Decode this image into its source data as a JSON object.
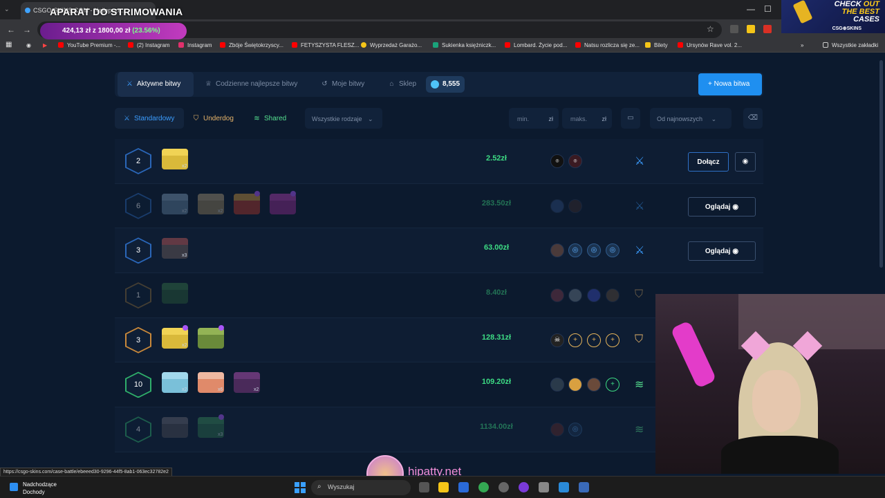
{
  "browser": {
    "tab_title": "CSGO-SKINS.COM - Najlepsze...",
    "overlay_title": "APARAT DO STRIMOWANIA",
    "money_overlay": {
      "text": "424,13 zł z 1800,00 zł",
      "percent": "(23.56%)"
    },
    "bookmarks": [
      {
        "label": "YouTube Premium -...",
        "color": "#ff0000"
      },
      {
        "label": "(2) Instagram",
        "color": "#ff0000"
      },
      {
        "label": "Instagram",
        "color": "#e1306c"
      },
      {
        "label": "Zbóje Świętokrzyscy...",
        "color": "#ff0000"
      },
      {
        "label": "FETYSZYSTA FLESZ...",
        "color": "#ff0000"
      },
      {
        "label": "Wyprzedaż Garażo...",
        "color": "#f5c518"
      },
      {
        "label": "Sukienka księżniczk...",
        "color": "#1aa37a"
      },
      {
        "label": "Lombard. Życie pod...",
        "color": "#ff0000"
      },
      {
        "label": "Natsu rozlicza się ze...",
        "color": "#ff0000"
      },
      {
        "label": "Bilety",
        "color": "#f5c518"
      },
      {
        "label": "Ursynów Rave vol. 2...",
        "color": "#ff0000"
      }
    ],
    "all_bookmarks": "Wszystkie zakładki",
    "status_url": "https://csgo-skins.com/case-battle/ebeeed30-9296-44f5-8ab1-063ec32782e2"
  },
  "promo": {
    "line1": "CHECK",
    "line1b": "OUT",
    "line2": "THE BEST",
    "line3": "CASES",
    "logo": "CSG⊕SKINS"
  },
  "nav": {
    "active": "Aktywne bitwy",
    "daily": "Codzienne najlepsze bitwy",
    "mine": "Moje bitwy",
    "shop": "Sklep",
    "coins": "8,555",
    "new_battle": "+ Nowa bitwa"
  },
  "filters": {
    "standard": "Standardowy",
    "underdog": "Underdog",
    "shared": "Shared",
    "all_types": "Wszystkie rodzaje",
    "min_placeholder": "min.",
    "max_placeholder": "maks.",
    "currency": "zł",
    "sort": "Od najnowszych"
  },
  "battles": [
    {
      "rounds": "2",
      "price": "2.52zł",
      "mode": "standard",
      "action": "Dołącz",
      "hex": "#2a66b8",
      "dim": false
    },
    {
      "rounds": "6",
      "price": "283.50zł",
      "mode": "standard",
      "action": "Oglądaj",
      "hex": "#2a66b8",
      "dim": true
    },
    {
      "rounds": "3",
      "price": "63.00zł",
      "mode": "standard",
      "action": "Oglądaj",
      "hex": "#2a66b8",
      "dim": false
    },
    {
      "rounds": "1",
      "price": "8.40zł",
      "mode": "underdog",
      "action": "",
      "hex": "#8a6a3a",
      "dim": true
    },
    {
      "rounds": "3",
      "price": "128.31zł",
      "mode": "underdog",
      "action": "",
      "hex": "#c9883a",
      "dim": false
    },
    {
      "rounds": "10",
      "price": "109.20zł",
      "mode": "shared",
      "action": "",
      "hex": "#2fae6a",
      "dim": false
    },
    {
      "rounds": "4",
      "price": "1134.00zł",
      "mode": "shared",
      "action": "",
      "hex": "#2fae6a",
      "dim": true
    }
  ],
  "labels": {
    "x2": "x2",
    "x3": "x3",
    "x6": "x6"
  },
  "stream": {
    "name": "hipatty.net"
  },
  "taskbar": {
    "weather_title": "Nadchodzące",
    "weather_sub": "Dochody",
    "search": "Wyszukaj"
  },
  "colors": {
    "accent": "#1f8ff0",
    "price_green": "#3ddc84",
    "underdog": "#e8b56a",
    "shared": "#55e08f"
  }
}
